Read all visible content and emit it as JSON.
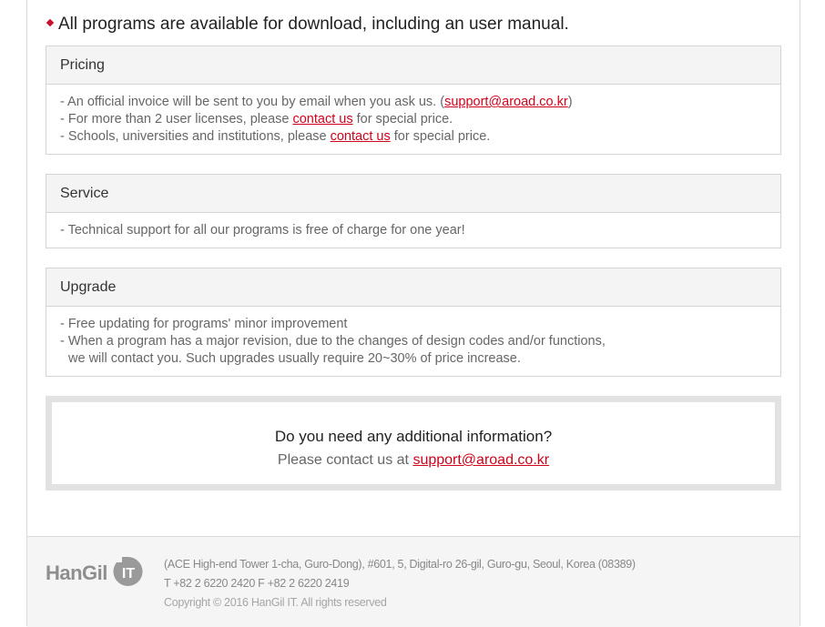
{
  "headline": "All programs are available for download, including an user manual.",
  "pricing": {
    "title": "Pricing",
    "line1_prefix": "- An official invoice will be sent to you by email when you ask us. (",
    "line1_email": "support@aroad.co.kr",
    "line1_suffix": ")",
    "line2_prefix": "- For more than 2 user licenses, please ",
    "line2_link": "contact us",
    "line2_suffix": " for special price.",
    "line3_prefix": "- Schools, universities and institutions, please ",
    "line3_link": "contact us",
    "line3_suffix": " for special price."
  },
  "service": {
    "title": "Service",
    "line1": "- Technical support for all our programs is free of charge for one year!"
  },
  "upgrade": {
    "title": "Upgrade",
    "line1": "- Free updating for programs' minor improvement",
    "line2": "- When a program has a major revision, due to the changes of design codes and/or functions,",
    "line3": "we will contact you. Such upgrades usually require 20~30% of price increase."
  },
  "contact_box": {
    "question": "Do you need any additional information?",
    "prefix": "Please contact us at ",
    "email": "support@aroad.co.kr"
  },
  "footer": {
    "logo_text": "HanGil",
    "logo_badge": "IT",
    "address": "(ACE High-end Tower 1-cha, Guro-Dong), #601, 5, Digital-ro 26-gil, Guro-gu, Seoul, Korea (08389)",
    "phone": "T +82 2 6220 2420 F +82 2 6220 2419",
    "copyright": "Copyright © 2016 HanGil IT. All rights reserved"
  },
  "colors": {
    "accent": "#d0021b",
    "footer_bg": "#f5f5f5",
    "box_head_bg": "#f4f4f4"
  }
}
